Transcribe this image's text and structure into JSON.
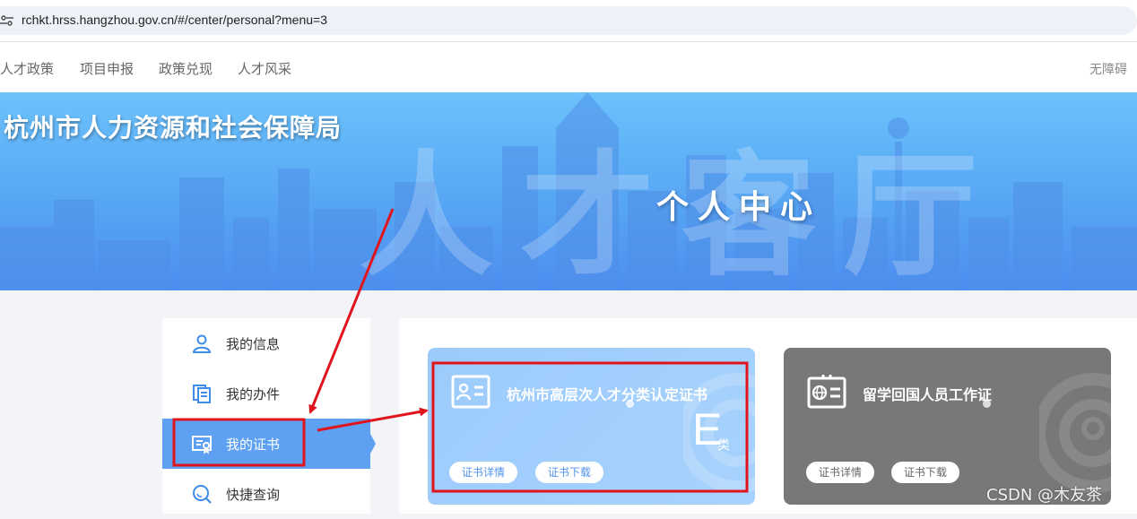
{
  "browser": {
    "url": "rchkt.hrss.hangzhou.gov.cn/#/center/personal?menu=3"
  },
  "topnav": {
    "items": [
      "人才政策",
      "项目申报",
      "政策兑现",
      "人才风采"
    ],
    "accessibility": "无障碍"
  },
  "banner": {
    "title": "杭州市人力资源和社会保障局",
    "center_title": "个人中心"
  },
  "sidebar": {
    "items": [
      {
        "label": "我的信息",
        "icon": "user-icon"
      },
      {
        "label": "我的办件",
        "icon": "documents-icon"
      },
      {
        "label": "我的证书",
        "icon": "certificate-icon",
        "active": true
      },
      {
        "label": "快捷查询",
        "icon": "search-icon"
      }
    ]
  },
  "cards": [
    {
      "title": "杭州市高层次人才分类认定证书",
      "grade": "E",
      "grade_suffix": "类",
      "detail_btn": "证书详情",
      "download_btn": "证书下载",
      "color": "#a2cffc"
    },
    {
      "title": "留学回国人员工作证",
      "detail_btn": "证书详情",
      "download_btn": "证书下载",
      "color": "#787878"
    }
  ],
  "watermark": "CSDN @木友茶",
  "colors": {
    "accent": "#5ea0f2",
    "annotation_red": "#e0141c"
  }
}
